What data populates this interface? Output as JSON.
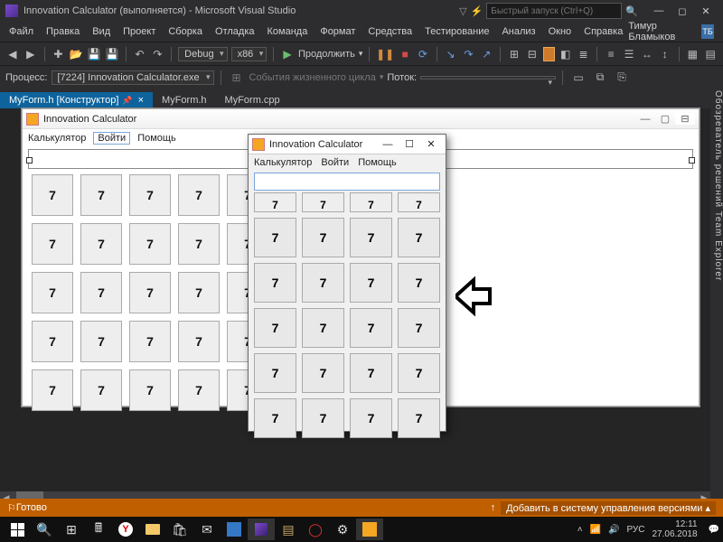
{
  "titlebar": {
    "text": "Innovation Calculator (выполняется) - Microsoft Visual Studio",
    "quick_launch_placeholder": "Быстрый запуск (Ctrl+Q)"
  },
  "user": {
    "name": "Тимур Бламыков",
    "badge": "ТБ"
  },
  "menu": [
    "Файл",
    "Правка",
    "Вид",
    "Проект",
    "Сборка",
    "Отладка",
    "Команда",
    "Формат",
    "Средства",
    "Тестирование",
    "Анализ",
    "Окно",
    "Справка"
  ],
  "toolbar1": {
    "config": "Debug",
    "platform": "x86",
    "run_label": "Продолжить"
  },
  "toolbar2": {
    "process_label": "Процесс:",
    "process_value": "[7224] Innovation Calculator.exe",
    "lifecycle_label": "События жизненного цикла",
    "thread_label": "Поток:"
  },
  "tabs": [
    {
      "label": "MyForm.h [Конструктор]",
      "active": true
    },
    {
      "label": "MyForm.h",
      "active": false
    },
    {
      "label": "MyForm.cpp",
      "active": false
    }
  ],
  "side_tabs": "Обозреватель решений   Team Explorer",
  "form_designer": {
    "title": "Innovation Calculator",
    "menu": [
      "Калькулятор",
      "Войти",
      "Помощь"
    ],
    "selected_menu_index": 1,
    "button_label": "7",
    "rows": 5,
    "cols": 5
  },
  "form_running": {
    "title": "Innovation Calculator",
    "menu": [
      "Калькулятор",
      "Войти",
      "Помощь"
    ],
    "button_label": "7",
    "rows": 5,
    "cols": 4
  },
  "statusbar": {
    "left": "Готово",
    "right": "Добавить в систему управления версиями"
  },
  "tray": {
    "lang": "РУС",
    "time": "12:11",
    "date": "27.06.2018"
  }
}
